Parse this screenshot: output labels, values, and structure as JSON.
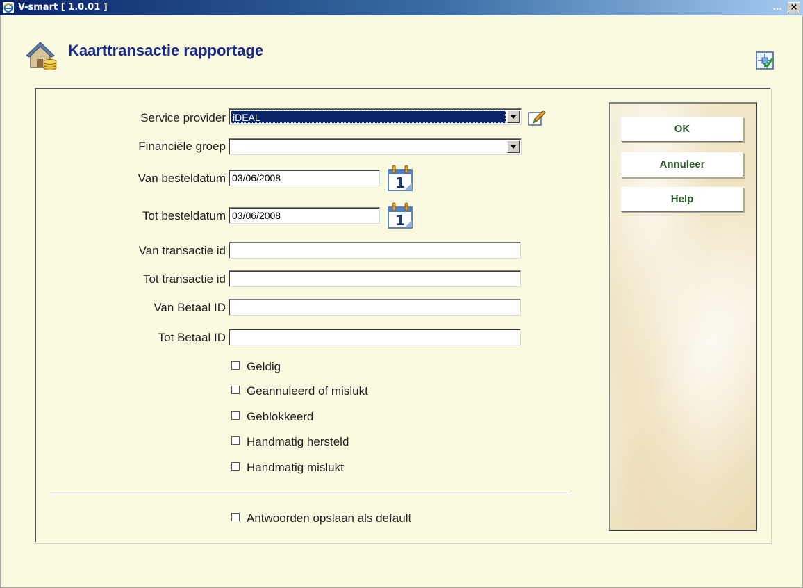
{
  "window": {
    "title": "V-smart [ 1.0.01 ]",
    "minimize": "...",
    "close": "×"
  },
  "page": {
    "title": "Kaarttransactie rapportage"
  },
  "form": {
    "service_provider": {
      "label": "Service provider",
      "value": "iDEAL"
    },
    "financiele_groep": {
      "label": "Financiële groep",
      "value": ""
    },
    "van_besteldatum": {
      "label": "Van besteldatum",
      "value": "03/06/2008"
    },
    "tot_besteldatum": {
      "label": "Tot besteldatum",
      "value": "03/06/2008"
    },
    "van_transactie_id": {
      "label": "Van transactie id",
      "value": ""
    },
    "tot_transactie_id": {
      "label": "Tot transactie id",
      "value": ""
    },
    "van_betaal_id": {
      "label": "Van Betaal ID",
      "value": ""
    },
    "tot_betaal_id": {
      "label": "Tot Betaal ID",
      "value": ""
    },
    "checkboxes": [
      {
        "label": "Geldig",
        "checked": false
      },
      {
        "label": "Geannuleerd of mislukt",
        "checked": false
      },
      {
        "label": "Geblokkeerd",
        "checked": false
      },
      {
        "label": "Handmatig hersteld",
        "checked": false
      },
      {
        "label": "Handmatig mislukt",
        "checked": false
      }
    ],
    "save_default": {
      "label": "Antwoorden opslaan als default",
      "checked": false
    }
  },
  "buttons": {
    "ok": "OK",
    "cancel": "Annuleer",
    "help": "Help"
  },
  "icons": {
    "app": "ie-icon",
    "page": "house-coins-icon",
    "header_tool": "layout-check-icon",
    "edit": "pencil-icon",
    "calendar": "calendar-icon"
  }
}
